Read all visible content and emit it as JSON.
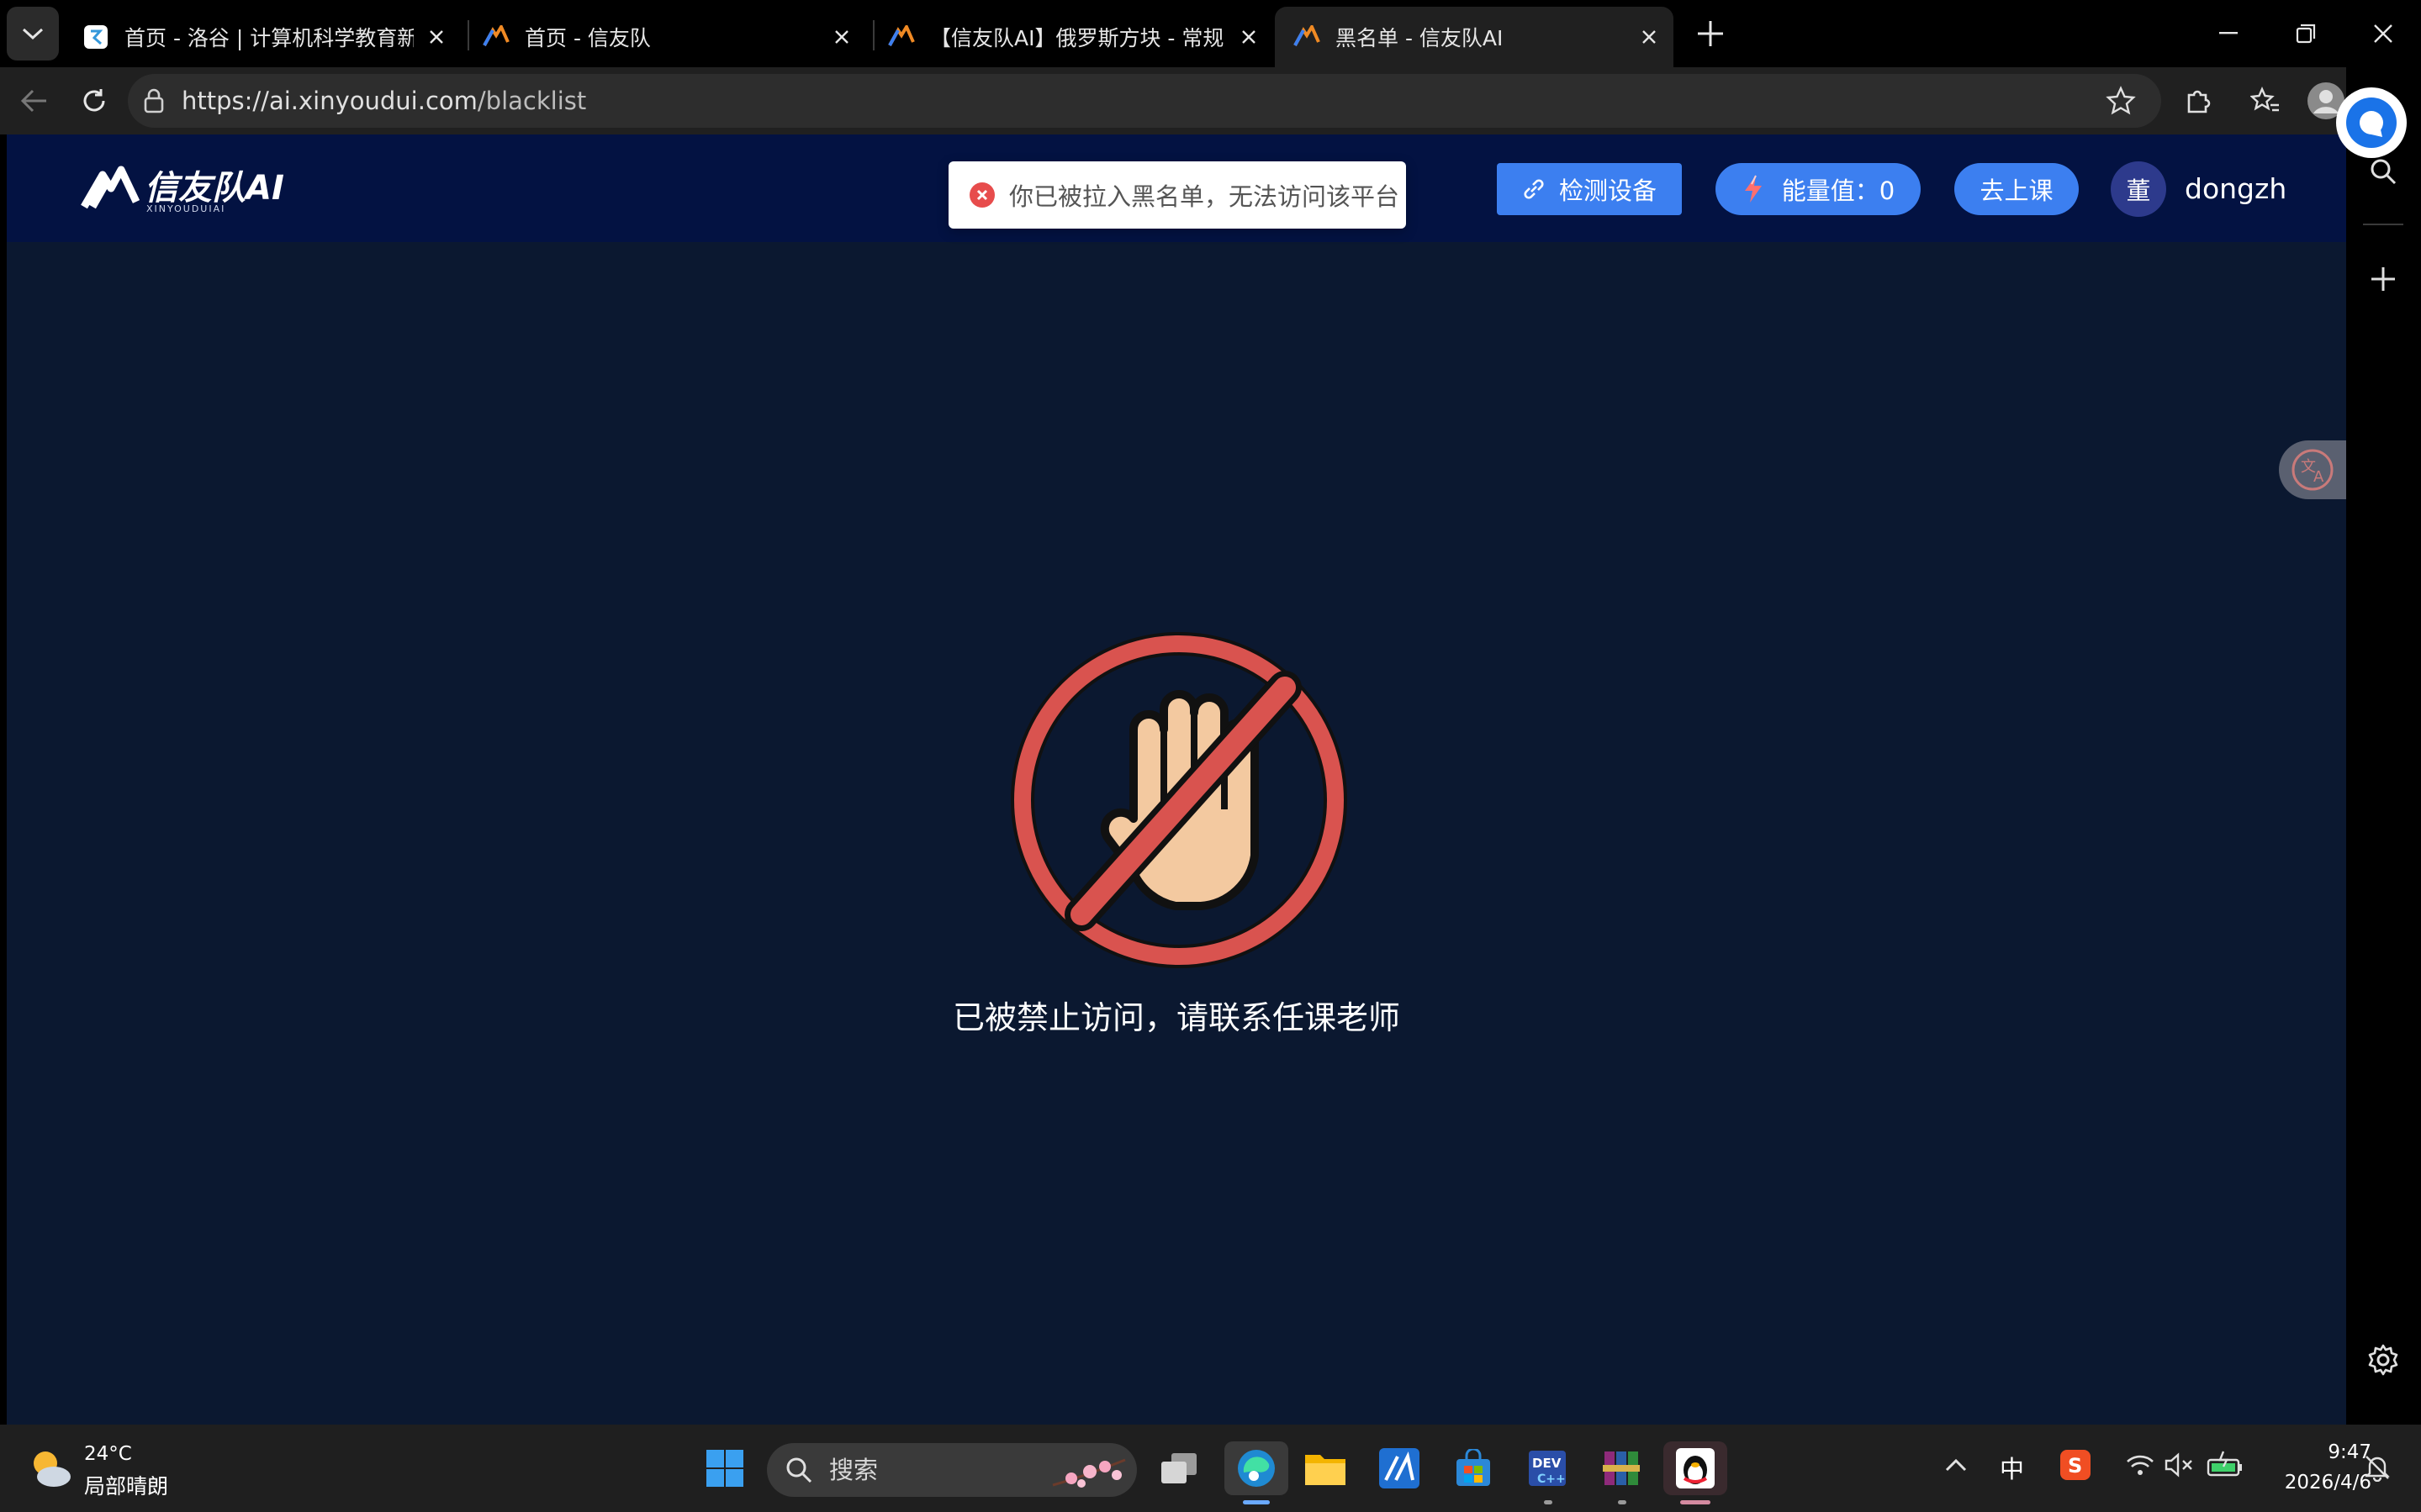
{
  "browser": {
    "tabs": [
      {
        "title": "首页 - 洛谷 | 计算机科学教育新生态",
        "favicon": "luogu-logo-icon",
        "active": false
      },
      {
        "title": "首页 - 信友队",
        "favicon": "xinyoudui-logo-icon",
        "active": false
      },
      {
        "title": "【信友队AI】俄罗斯方块 - 常规 - 信友队AI",
        "favicon": "xinyoudui-logo-icon",
        "active": false
      },
      {
        "title": "黑名单 - 信友队AI",
        "favicon": "xinyoudui-logo-icon",
        "active": true
      }
    ],
    "address": {
      "url_host": "https://ai.xinyoudui.com",
      "url_path": "/blacklist"
    }
  },
  "site": {
    "logo_text": "信友队AI",
    "logo_sub": "XINYOUDUIAI",
    "toast_message": "你已被拉入黑名单，无法访问该平台",
    "detect_button": "检测设备",
    "energy_button": "能量值：0",
    "class_button": "去上课",
    "avatar_text": "董",
    "username": "dongzh",
    "blocked_message": "已被禁止访问，请联系任课老师"
  },
  "taskbar": {
    "weather_temp": "24°C",
    "weather_desc": "局部晴朗",
    "search_placeholder": "搜索",
    "ime": "中",
    "time": "9:47",
    "date": "2026/4/6"
  },
  "colors": {
    "page_bg": "#0b1830",
    "header_bg": "#031242",
    "button_blue": "#3c7ff0",
    "stop_red": "#d9534f",
    "error_red": "#e74c4c"
  }
}
